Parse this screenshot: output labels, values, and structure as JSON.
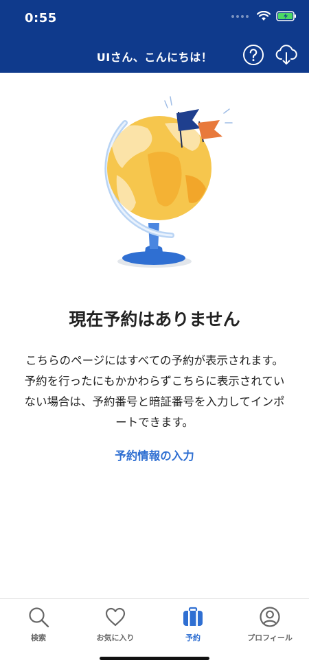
{
  "status_bar": {
    "time": "0:55"
  },
  "header": {
    "greeting": "UIさん、こんにちは！"
  },
  "empty_state": {
    "title": "現在予約はありません",
    "description": "こちらのページにはすべての予約が表示されます。予約を行ったにもかかわらずこちらに表示されていない場合は、予約番号と暗証番号を入力してインポートできます。",
    "link_label": "予約情報の入力"
  },
  "tabs": [
    {
      "label": "検索",
      "icon": "search-icon"
    },
    {
      "label": "お気に入り",
      "icon": "heart-icon"
    },
    {
      "label": "予約",
      "icon": "suitcase-icon"
    },
    {
      "label": "プロフィール",
      "icon": "profile-icon"
    }
  ],
  "colors": {
    "header_bg": "#0f3a8c",
    "accent": "#2f6fd2",
    "battery": "#4cd964"
  }
}
